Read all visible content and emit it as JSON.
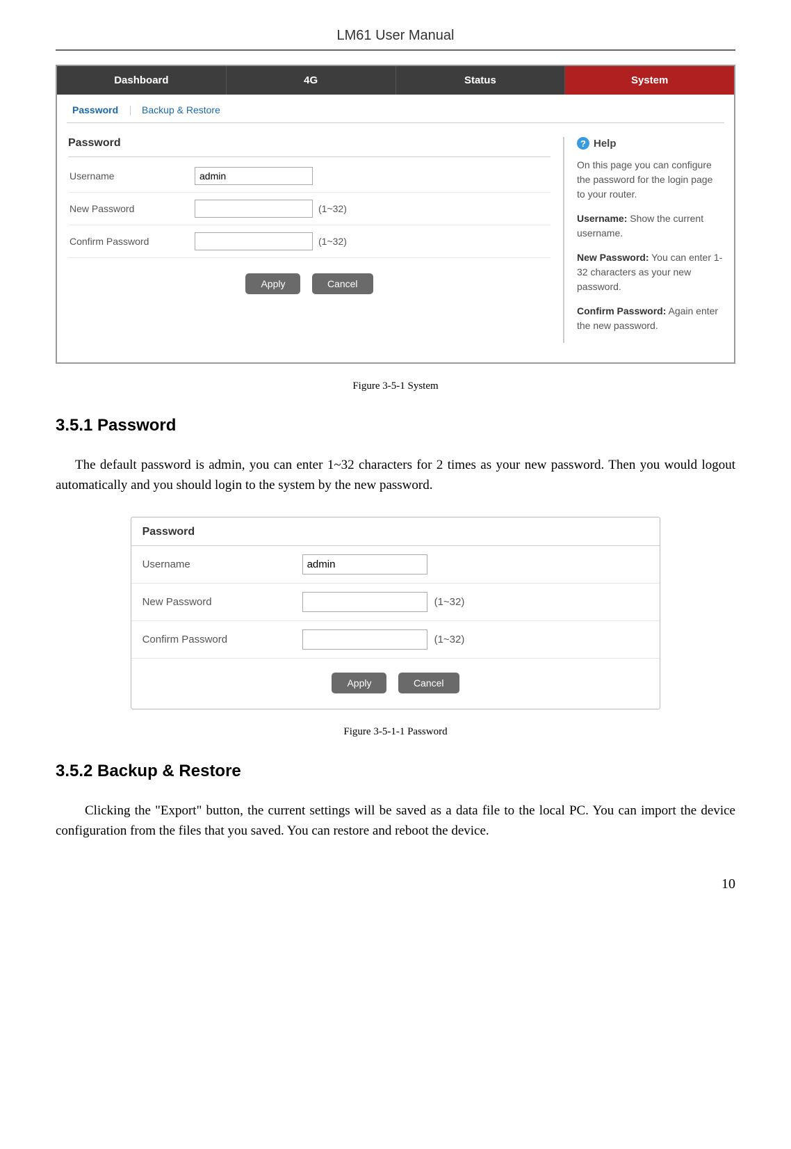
{
  "doc_header": "LM61 User Manual",
  "screenshot1": {
    "nav": [
      "Dashboard",
      "4G",
      "Status",
      "System"
    ],
    "nav_active_index": 3,
    "subtabs": [
      "Password",
      "Backup & Restore"
    ],
    "subtab_active_index": 0,
    "panel_title": "Password",
    "rows": {
      "username_label": "Username",
      "username_value": "admin",
      "newpass_label": "New Password",
      "newpass_hint": "(1~32)",
      "confirm_label": "Confirm Password",
      "confirm_hint": "(1~32)"
    },
    "buttons": {
      "apply": "Apply",
      "cancel": "Cancel"
    },
    "help": {
      "title": "Help",
      "p1": "On this page you can configure the password for the login page to your router.",
      "p2_b": "Username:",
      "p2": " Show the current username.",
      "p3_b": "New Password:",
      "p3": " You can enter 1-32 characters as your new password.",
      "p4_b": "Confirm Password:",
      "p4": " Again enter the new password."
    }
  },
  "figure1_caption": "Figure 3-5-1 System",
  "section_351_title": "3.5.1 Password",
  "section_351_body": "The default password is admin, you can enter 1~32 characters for 2 times as your new password. Then you would logout automatically and you should login to the system by the new password.",
  "screenshot2": {
    "panel_title": "Password",
    "rows": {
      "username_label": "Username",
      "username_value": "admin",
      "newpass_label": "New Password",
      "newpass_hint": "(1~32)",
      "confirm_label": "Confirm Password",
      "confirm_hint": "(1~32)"
    },
    "buttons": {
      "apply": "Apply",
      "cancel": "Cancel"
    }
  },
  "figure2_caption": "Figure 3-5-1-1 Password",
  "section_352_title": "3.5.2 Backup & Restore",
  "section_352_body": "Clicking the \"Export\" button, the current settings will be saved as a data file to the local PC. You can import the device configuration from the files that you saved. You can restore and reboot the device.",
  "page_number": "10"
}
